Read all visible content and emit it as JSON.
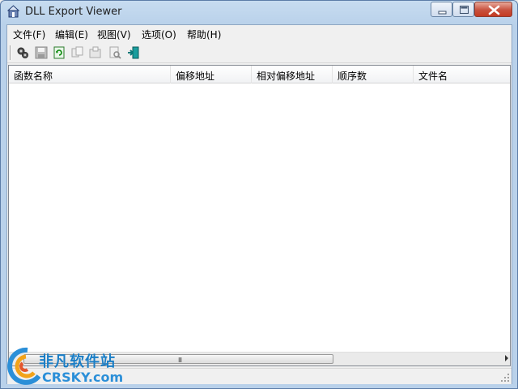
{
  "window": {
    "title": "DLL Export Viewer"
  },
  "menu": {
    "items": [
      "文件(F)",
      "编辑(E)",
      "视图(V)",
      "选项(O)",
      "帮助(H)"
    ]
  },
  "toolbar": {
    "buttons": [
      "properties-icon",
      "save-icon",
      "refresh-icon",
      "copy-icon",
      "html-report-icon",
      "find-icon",
      "exit-icon"
    ]
  },
  "list": {
    "columns": [
      "函数名称",
      "偏移地址",
      "相对偏移地址",
      "顺序数",
      "文件名"
    ],
    "rows": []
  },
  "scrollbar": {
    "grip": "III"
  },
  "watermark": {
    "chinese": "非凡软件站",
    "english": "CRSKY.com"
  },
  "colors": {
    "close_button": "#c43a22",
    "title_bar": "#b9d1ea",
    "watermark": "#1a7ec6"
  }
}
